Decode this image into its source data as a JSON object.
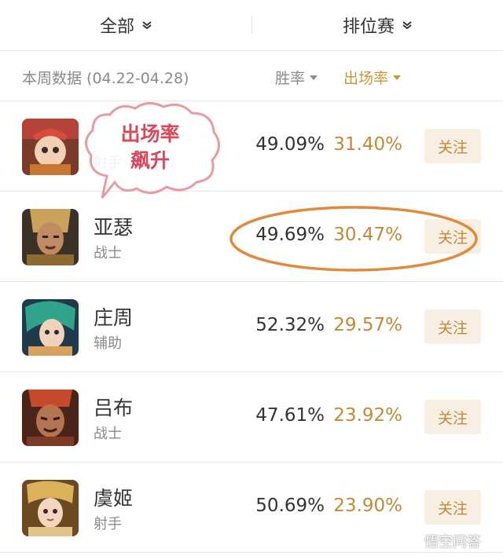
{
  "filters": {
    "category": "全部",
    "mode": "排位赛"
  },
  "stats_header": {
    "period": "本周数据 (04.22-04.28)",
    "win_rate_label": "胜率",
    "pick_rate_label": "出场率"
  },
  "heroes": [
    {
      "name": "",
      "role": "射手",
      "win_rate": "49.09%",
      "pick_rate": "31.40%",
      "follow": "关注"
    },
    {
      "name": "亚瑟",
      "role": "战士",
      "win_rate": "49.69%",
      "pick_rate": "30.47%",
      "follow": "关注"
    },
    {
      "name": "庄周",
      "role": "辅助",
      "win_rate": "52.32%",
      "pick_rate": "29.57%",
      "follow": "关注"
    },
    {
      "name": "吕布",
      "role": "战士",
      "win_rate": "47.61%",
      "pick_rate": "23.92%",
      "follow": "关注"
    },
    {
      "name": "虞姬",
      "role": "射手",
      "win_rate": "50.69%",
      "pick_rate": "23.90%",
      "follow": "关注"
    }
  ],
  "annotation": {
    "line1": "出场率",
    "line2": "飙升",
    "color": "#d9475a"
  },
  "accent_color": "#c28a36",
  "watermark": "悟空问答"
}
